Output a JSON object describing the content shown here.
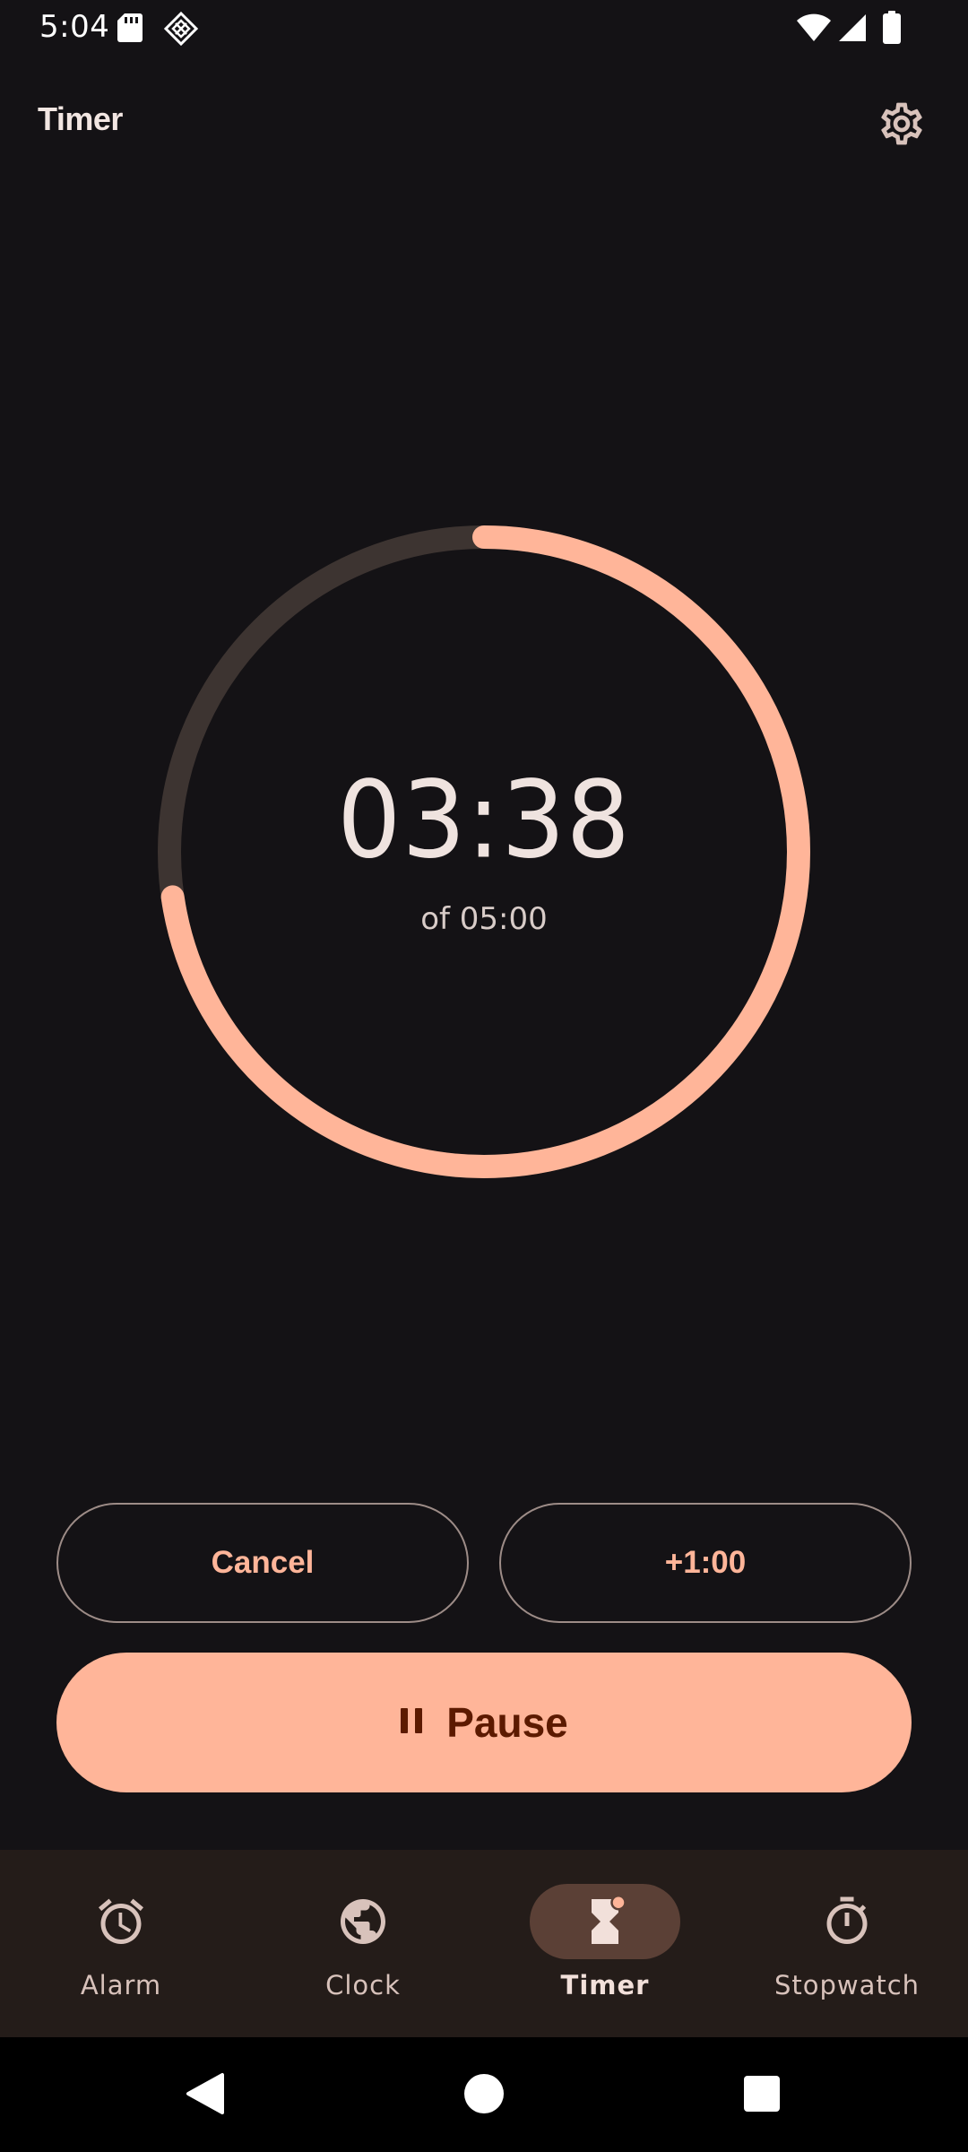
{
  "status_bar": {
    "time": "5:04",
    "left_icons": [
      "sd-card-icon",
      "vpn-diamond-icon"
    ],
    "right_icons": [
      "wifi-icon",
      "cellular-signal-icon",
      "battery-icon"
    ]
  },
  "app_bar": {
    "title": "Timer",
    "settings_icon": "gear-icon"
  },
  "timer": {
    "remaining": "03:38",
    "total": "of 05:00",
    "progress_remaining_fraction": 0.727,
    "ring_track_color": "#3d3431",
    "ring_progress_color": "#ffb599"
  },
  "actions": {
    "cancel_label": "Cancel",
    "add_minute_label": "+1:00",
    "pause_label": "Pause",
    "pause_icon": "pause-icon"
  },
  "bottom_nav": {
    "items": [
      {
        "label": "Alarm",
        "icon": "alarm-clock-icon",
        "active": false
      },
      {
        "label": "Clock",
        "icon": "globe-icon",
        "active": false
      },
      {
        "label": "Timer",
        "icon": "hourglass-icon",
        "active": true
      },
      {
        "label": "Stopwatch",
        "icon": "stopwatch-icon",
        "active": false
      }
    ]
  },
  "system_nav": {
    "icons": [
      "back-icon",
      "home-icon",
      "recents-icon"
    ]
  },
  "colors": {
    "background": "#141215",
    "accent": "#ffb599",
    "on_accent": "#5c1a00",
    "nav_background": "#241c19",
    "nav_active_indicator": "#5b4036"
  }
}
